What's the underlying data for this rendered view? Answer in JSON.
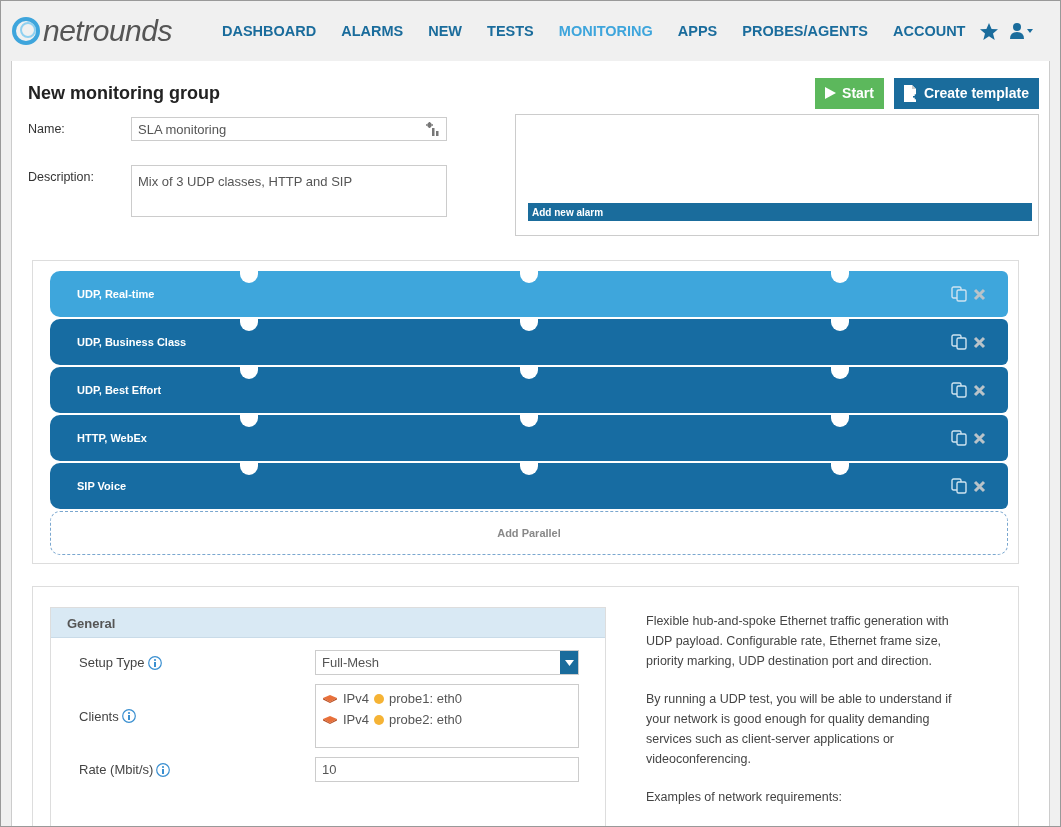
{
  "header": {
    "logo": "netrounds",
    "nav": [
      {
        "label": "DASHBOARD",
        "selected": false
      },
      {
        "label": "ALARMS",
        "selected": false
      },
      {
        "label": "NEW",
        "selected": false
      },
      {
        "label": "TESTS",
        "selected": false
      },
      {
        "label": "MONITORING",
        "selected": true
      },
      {
        "label": "APPS",
        "selected": false
      },
      {
        "label": "PROBES/AGENTS",
        "selected": false
      },
      {
        "label": "ACCOUNT",
        "selected": false
      }
    ]
  },
  "page": {
    "title": "New monitoring group",
    "buttons": [
      {
        "kind": "start",
        "label": "Start"
      },
      {
        "kind": "template",
        "label": "Create template"
      }
    ]
  },
  "form": {
    "name_label": "Name:",
    "name_value": "SLA monitoring",
    "description_label": "Description:",
    "description_value": "Mix of 3 UDP classes, HTTP and SIP"
  },
  "alarms": {
    "add_label": "Add new alarm"
  },
  "tests": [
    {
      "label": "UDP, Real-time",
      "selected": true
    },
    {
      "label": "UDP, Business Class",
      "selected": false
    },
    {
      "label": "UDP, Best Effort",
      "selected": false
    },
    {
      "label": "HTTP, WebEx",
      "selected": false
    },
    {
      "label": "SIP Voice",
      "selected": false
    }
  ],
  "add_parallel": "Add Parallel",
  "general": {
    "title": "General",
    "setup_type": {
      "label": "Setup Type",
      "value": "Full-Mesh"
    },
    "clients": {
      "label": "Clients",
      "items": [
        {
          "protocol": "IPv4",
          "name": "probe1: eth0",
          "color": "#f5b335"
        },
        {
          "protocol": "IPv4",
          "name": "probe2: eth0",
          "color": "#f5b335"
        }
      ]
    },
    "rate": {
      "label": "Rate (Mbit/s)",
      "value": "10"
    }
  },
  "help": [
    "Flexible hub-and-spoke Ethernet traffic generation with UDP payload. Configurable rate, Ethernet frame size, priority marking, UDP destination port and direction.",
    "By running a UDP test, you will be able to understand if your network is good enough for quality demanding services such as client-server applications or videoconferencing.",
    "Examples of network requirements:"
  ]
}
